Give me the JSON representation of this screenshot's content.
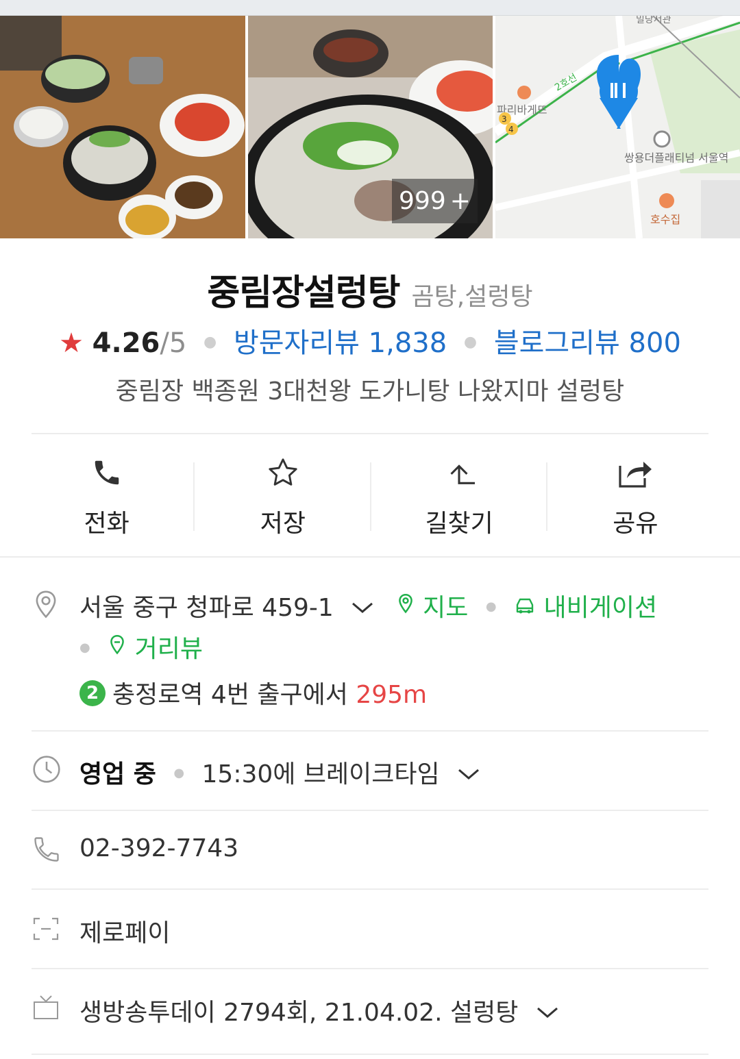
{
  "photos": {
    "photo_count": "999",
    "photo_count_suffix": "+",
    "map_labels": {
      "line": "2호선",
      "bakery": "파리바게뜨",
      "station_exit_3": "3",
      "station_exit_4": "4",
      "building": "쌍용더플래티넘 서울역",
      "restaurant": "호수집",
      "top_label": "밀당서관"
    }
  },
  "place": {
    "name": "중림장설렁탕",
    "category": "곰탕,설렁탕",
    "rating": "4.26",
    "rating_max": "/5",
    "visitor_reviews": "방문자리뷰 1,838",
    "blog_reviews": "블로그리뷰 800",
    "description": "중림장 백종원 3대천왕 도가니탕 나왔지마 설렁탕"
  },
  "actions": [
    {
      "label": "전화",
      "icon": "phone-icon"
    },
    {
      "label": "저장",
      "icon": "star-icon"
    },
    {
      "label": "길찾기",
      "icon": "directions-icon"
    },
    {
      "label": "공유",
      "icon": "share-icon"
    }
  ],
  "address": {
    "text": "서울 중구 청파로 459-1",
    "map_link": "지도",
    "navigation_link": "내비게이션",
    "streetview_link": "거리뷰",
    "subway_line": "2",
    "subway_text": "충정로역 4번 출구에서",
    "subway_distance": "295m"
  },
  "hours": {
    "status": "영업 중",
    "detail": "15:30에 브레이크타임"
  },
  "phone": {
    "number": "02-392-7743"
  },
  "payment": {
    "text": "제로페이"
  },
  "tv": {
    "text": "생방송투데이 2794회, 21.04.02. 설렁탕"
  },
  "colors": {
    "accent_blue": "#1f6fc9",
    "accent_green": "#20b04b",
    "distance_red": "#e64545",
    "star_red": "#e03c3c"
  }
}
